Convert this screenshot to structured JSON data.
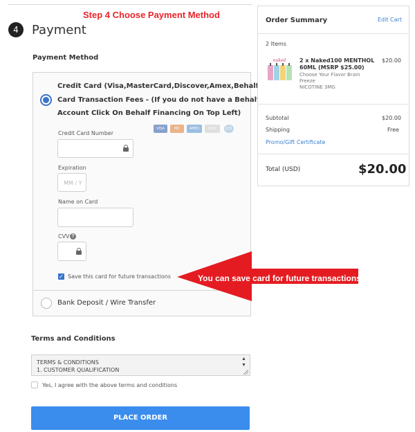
{
  "step_banner": "Step 4 Choose Payment Method",
  "step": {
    "number": "4",
    "title": "Payment"
  },
  "payment_method": {
    "heading": "Payment Method",
    "credit_card_lines": [
      "Credit Card (Visa,MasterCard,Discover,Amex,Behalf) - No",
      "Card Transaction Fees - (If you do not have a Behalf",
      "Account Click On Behalf Financing On Top Left)"
    ],
    "credit_card_selected": true,
    "card_logos": [
      "VISA",
      "MC",
      "AMEX",
      "DISC",
      "JCB"
    ],
    "fields": {
      "card_number_label": "Credit Card Number",
      "card_number_value": "",
      "expiration_label": "Expiration",
      "expiration_placeholder": "MM / Y",
      "name_label": "Name on Card",
      "name_value": "",
      "cvv_label": "CVV",
      "cvv_value": ""
    },
    "save_card": {
      "label": "Save this card for future transactions",
      "checked": true
    },
    "bank_option": {
      "label": "Bank Deposit / Wire Transfer",
      "selected": false
    }
  },
  "callout": "You can save card for future transactions",
  "terms": {
    "heading": "Terms and Conditions",
    "lines": [
      "TERMS & CONDITIONS",
      "1. CUSTOMER QUALIFICATION"
    ],
    "agree_label": "Yes, I agree with the above terms and conditions",
    "agree_checked": false
  },
  "place_order_label": "PLACE ORDER",
  "order_summary": {
    "title": "Order Summary",
    "edit_cart": "Edit Cart",
    "items_count": "2 Items",
    "item": {
      "name_line1": "2 x Naked100 MENTHOL",
      "name_line2": "60ML (MSRP $25.00)",
      "option_line1": "Choose Your Flavor Brain",
      "option_line2": "Freeze",
      "option_line3": "NICOTINE 3MG",
      "price": "$20.00"
    },
    "subtotal_label": "Subtotal",
    "subtotal_value": "$20.00",
    "shipping_label": "Shipping",
    "shipping_value": "Free",
    "promo_link": "Promo/Gift Certificate",
    "total_label": "Total (USD)",
    "total_value": "$20.00"
  },
  "colors": {
    "banner_red": "#e8242b",
    "accent_blue": "#3b8ded",
    "link_blue": "#3b7fd1",
    "callout_red": "#e41c22"
  }
}
